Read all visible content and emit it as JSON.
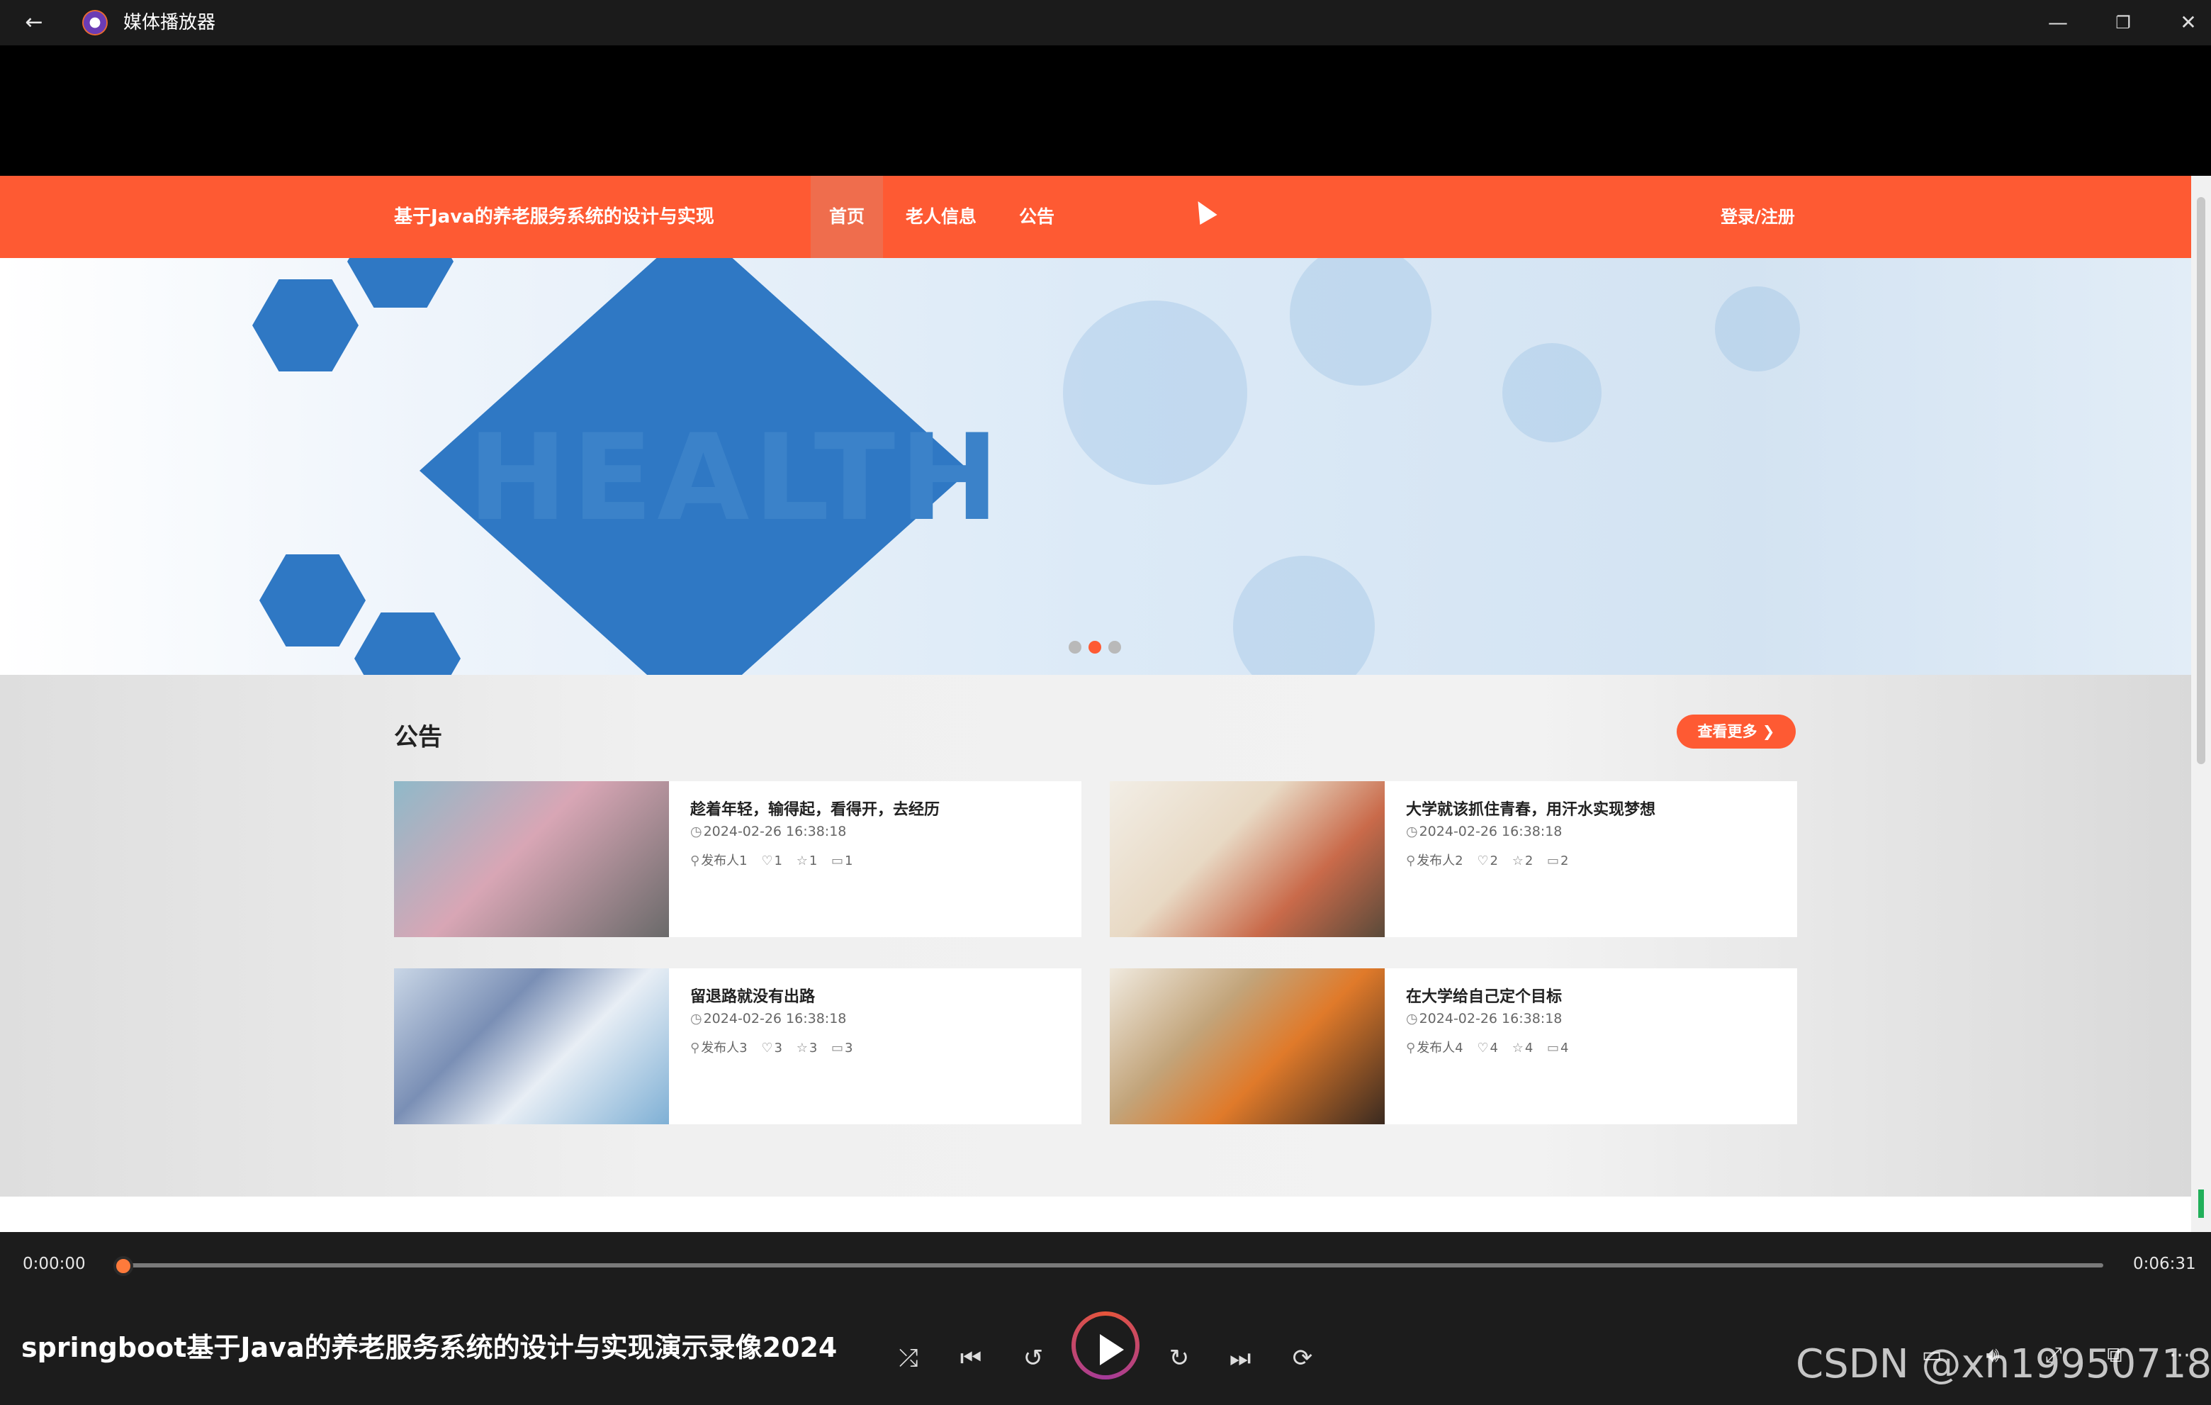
{
  "titlebar": {
    "back_icon": "←",
    "title": "媒体播放器",
    "minimize": "—",
    "restore": "❐",
    "close": "✕"
  },
  "site": {
    "title": "基于Java的养老服务系统的设计与实现",
    "nav": [
      "首页",
      "老人信息",
      "公告"
    ],
    "active_nav": "首页",
    "login": "登录/注册",
    "accent_color": "#fe5a33"
  },
  "banner": {
    "text": "HEALTH",
    "slide_count": 3,
    "active_slide": 2
  },
  "notices": {
    "title": "公告",
    "more_label": "查看更多 ❯",
    "items": [
      {
        "title": "趁着年轻，输得起，看得开，去经历",
        "date": "2024-02-26 16:38:18",
        "author": "发布人1",
        "likes": "1",
        "stars": "1",
        "comments": "1"
      },
      {
        "title": "大学就该抓住青春，用汗水实现梦想",
        "date": "2024-02-26 16:38:18",
        "author": "发布人2",
        "likes": "2",
        "stars": "2",
        "comments": "2"
      },
      {
        "title": "留退路就没有出路",
        "date": "2024-02-26 16:38:18",
        "author": "发布人3",
        "likes": "3",
        "stars": "3",
        "comments": "3"
      },
      {
        "title": "在大学给自己定个目标",
        "date": "2024-02-26 16:38:18",
        "author": "发布人4",
        "likes": "4",
        "stars": "4",
        "comments": "4"
      }
    ]
  },
  "player": {
    "current_time": "0:00:00",
    "total_time": "0:06:31",
    "progress": 0.0,
    "video_title": "springboot基于Java的养老服务系统的设计与实现演示录像2024",
    "watermark": "CSDN @xn19950718"
  }
}
